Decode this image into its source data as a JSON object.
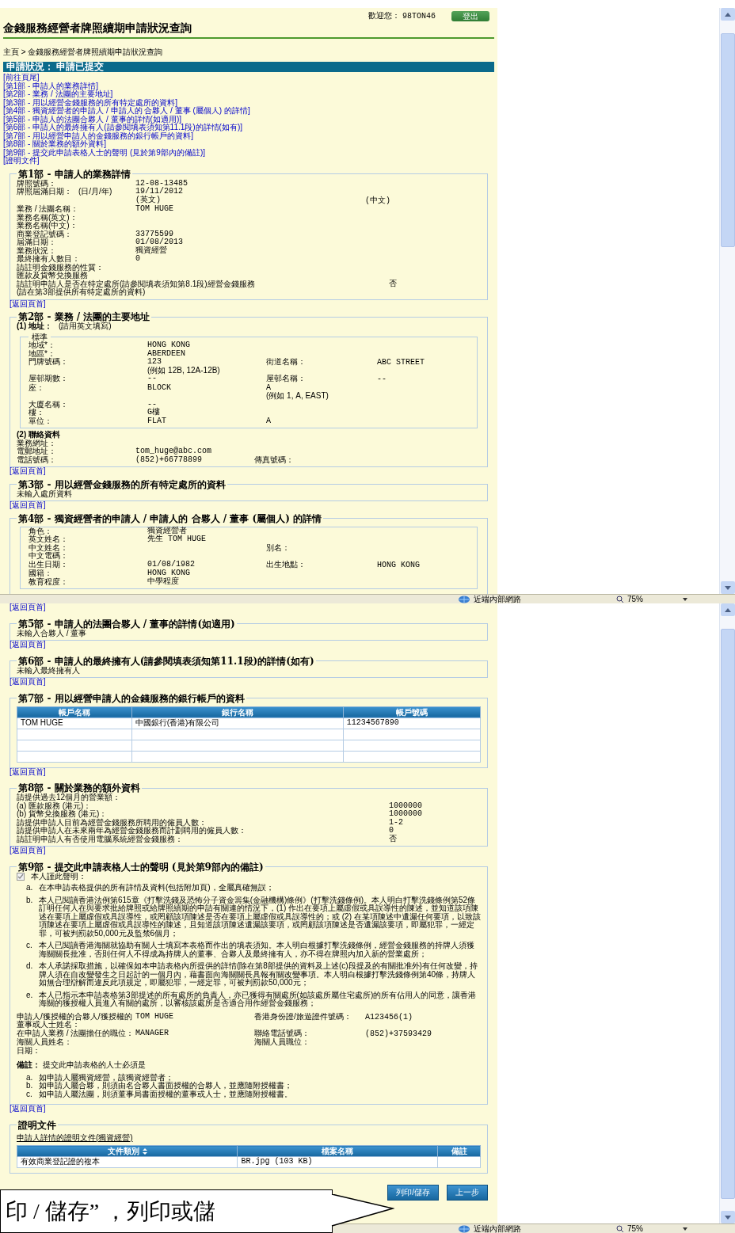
{
  "top_window": {
    "header": {
      "welcome": "歡迎您：",
      "user": "98TON46",
      "logout": "登出"
    },
    "title": "金錢服務經營者牌照續期申請狀況查詢",
    "breadcrumb": "主頁 > 金錢服務經營者牌照續期申請狀況查詢",
    "status_band": "申請狀況： 申請已提交",
    "nav_links": [
      "[前往頁尾]",
      "[第1部 - 申請人的業務詳情]",
      "[第2部 - 業務 / 法團的主要地址]",
      "[第3部 - 用以經營金錢服務的所有特定處所的資料]",
      "[第4部 - 獨資經營者的申請人 / 申請人的 合夥人 / 董事 (屬個人) 的詳情]",
      "[第5部 - 申請人的法團合夥人 / 董事的詳情(如適用)]",
      "[第6部 - 申請人的最終擁有人(請參閱填表須知第11.1段)的詳情(如有)]",
      "[第7部 - 用以經營申請人的金錢服務的銀行帳戶的資料]",
      "[第8部 - 關於業務的額外資料]",
      "[第9部 - 提交此申請表格人士的聲明 (見於第9部內的備註)]",
      "[證明文件]"
    ],
    "sections": [
      {
        "title": "第1部 - 申請人的業務詳情",
        "back_link": "[返回頁首]",
        "body": [
          {
            "kind": "row",
            "label": "牌照號碼：",
            "value": "12-08-13485"
          },
          {
            "kind": "row",
            "label": "牌照屆滿日期：",
            "label_note": "(日/月/年)",
            "value": "19/11/2012"
          },
          {
            "kind": "row",
            "value": "(英文)",
            "value2": "(中文)"
          },
          {
            "kind": "row",
            "label": "業務 / 法團名稱：",
            "value": "TOM HUGE"
          },
          {
            "kind": "row",
            "label": "業務名稱(英文)："
          },
          {
            "kind": "row",
            "label": "業務名稱(中文)："
          },
          {
            "kind": "row",
            "label": "商業登記號碼：",
            "value": "33775599"
          },
          {
            "kind": "row",
            "label": "屆滿日期：",
            "value": "01/08/2013"
          },
          {
            "kind": "row",
            "label": "業務狀況：",
            "value": "獨資經營"
          },
          {
            "kind": "row",
            "label": "最終擁有人數目：",
            "value": "0"
          },
          {
            "kind": "text",
            "text": "請註明金錢服務的性質："
          },
          {
            "kind": "text",
            "text": "匯款及貨幣兌換服務"
          },
          {
            "kind": "question",
            "text": "請註明申請人是否在特定處所(請參閱填表須知第8.1段)經營金錢服務",
            "answer": "否",
            "note": "(請在第3部提供所有特定處所的資料)"
          }
        ]
      },
      {
        "title": "第2部 - 業務 / 法團的主要地址",
        "back_link": "[返回頁首]",
        "body": [
          {
            "kind": "subhead",
            "text": "(1) 地址：",
            "note": "(請用英文填寫)"
          },
          {
            "kind": "group",
            "title": "標準",
            "items": [
              {
                "kind": "row",
                "label": "地域*：",
                "value": "HONG KONG"
              },
              {
                "kind": "row",
                "label": "地區*：",
                "value": "ABERDEEN"
              },
              {
                "kind": "row",
                "label": "門牌號碼：",
                "value": "123",
                "hint": "(例如 12B, 12A-12B)",
                "label2": "街道名稱：",
                "value2": "ABC STREET"
              },
              {
                "kind": "row",
                "label": "屋邨期數：",
                "value": "--",
                "label2": "屋邨名稱：",
                "value2": "--"
              },
              {
                "kind": "row",
                "label": "座：",
                "value": "BLOCK",
                "value_b": "A",
                "hint_b": "(例如 1, A, EAST)"
              },
              {
                "kind": "row",
                "label": "大廈名稱：",
                "value": "--"
              },
              {
                "kind": "row",
                "label": "樓：",
                "value": "G樓"
              },
              {
                "kind": "row",
                "label": "單位：",
                "value": "FLAT",
                "value_b": "A"
              }
            ]
          },
          {
            "kind": "subhead",
            "text": "(2) 聯絡資料"
          },
          {
            "kind": "row",
            "label": "業務網址："
          },
          {
            "kind": "row",
            "label": "電郵地址：",
            "value": "tom_huge@abc.com"
          },
          {
            "kind": "row",
            "label": "電話號碼：",
            "value": "(852)+66778899",
            "label2": "傳真號碼："
          }
        ]
      },
      {
        "title": "第3部 - 用以經營金錢服務的所有特定處所的資料",
        "back_link": "[返回頁首]",
        "body": [
          {
            "kind": "text",
            "text": "未輸入處所資料"
          }
        ]
      },
      {
        "title": "第4部 - 獨資經營者的申請人 / 申請人的 合夥人 / 董事 (屬個人) 的詳情",
        "body": [
          {
            "kind": "group",
            "items": [
              {
                "kind": "row",
                "label": "角色：",
                "value": "獨資經營者"
              },
              {
                "kind": "row",
                "label": "英文姓名：",
                "value": "先生 TOM HUGE"
              },
              {
                "kind": "row",
                "label": "中文姓名：",
                "label2": "別名："
              },
              {
                "kind": "row",
                "label": "中文電碼："
              },
              {
                "kind": "row",
                "label": "出生日期：",
                "value": "01/08/1982",
                "label2": "出生地點：",
                "value2": "HONG KONG"
              },
              {
                "kind": "row",
                "label": "國籍：",
                "value": "HONG KONG"
              },
              {
                "kind": "row",
                "label": "教育程度：",
                "value": "中學程度"
              }
            ]
          }
        ]
      }
    ],
    "status_bar": {
      "zone": "近端內部網路",
      "zoom": "75%"
    }
  },
  "bottom_window": {
    "top_link": "[返回頁首]",
    "sections": [
      {
        "title": "第5部 - 申請人的法團合夥人 / 董事的詳情(如適用)",
        "back_link": "[返回頁首]",
        "body": [
          {
            "kind": "text",
            "text": "未輸入合夥人 / 董事"
          }
        ]
      },
      {
        "title": "第6部 - 申請人的最終擁有人(請參閱填表須知第11.1段)的詳情(如有)",
        "back_link": "[返回頁首]",
        "body": [
          {
            "kind": "text",
            "text": "未輸入最終擁有人"
          }
        ]
      },
      {
        "title": "第7部 - 用以經營申請人的金錢服務的銀行帳戶的資料",
        "back_link": "[返回頁首]",
        "body": [
          {
            "kind": "table",
            "columns": [
              {
                "label": "帳戶名稱",
                "sortable": false
              },
              {
                "label": "銀行名稱",
                "sortable": false
              },
              {
                "label": "帳戶號碼",
                "sortable": false
              }
            ],
            "rows": [
              [
                "TOM HUGE",
                "中國銀行(香港)有限公司",
                "11234567890"
              ]
            ]
          }
        ]
      },
      {
        "title": "第8部 - 關於業務的額外資料",
        "back_link": "[返回頁首]",
        "body": [
          {
            "kind": "text",
            "text": "請提供過去12個月的營業額："
          },
          {
            "kind": "question",
            "text": "(a) 匯款服務 (港元)：",
            "answer": "1000000"
          },
          {
            "kind": "question",
            "text": "(b) 貨幣兌換服務 (港元)：",
            "answer": "1000000"
          },
          {
            "kind": "question",
            "text": "請提供申請人目前為經營金錢服務所聘用的僱員人數：",
            "answer": "1-2"
          },
          {
            "kind": "question",
            "text": "請提供申請人在未來兩年為經營金錢服務而計劃聘用的僱員人數：",
            "answer": "0"
          },
          {
            "kind": "question",
            "text": "請註明申請人有否使用電腦系統經營金錢服務：",
            "answer": "否"
          }
        ]
      },
      {
        "title": "第9部 - 提交此申請表格人士的聲明 (見於第9部內的備註)",
        "back_link": "[返回頁首]",
        "body": [
          {
            "kind": "declaration",
            "checkbox": {
              "label": "本人謹此聲明：",
              "checked": true
            },
            "clauses": [
              {
                "marker": "a.",
                "text": "在本申請表格提供的所有詳情及資料(包括附加頁)，全屬真確無誤；"
              },
              {
                "marker": "b.",
                "text": "本人已閱讀香港法例第615章《打擊洗錢及恐怖分子資金籌集(金融機構)條例》(打擊洗錢條例)。本人明白打擊洗錢條例第52條訂明任何人在與要求批給牌照或給牌照續期的申請有關連的情況下，(1) 作出在要項上屬虛假或具誤導性的陳述，並知道該項陳述在要項上屬虛假或具誤導性，或罔顧該項陳述是否在要項上屬虛假或具誤導性的；或 (2) 在某項陳述中遺漏任何要項，以致該項陳述在要項上屬虛假或具誤導性的陳述，且知道該項陳述遺漏該要項，或罔顧該項陳述是否遺漏該要項，即屬犯罪，一經定罪，可被判罰款50,000元及監禁6個月；"
              },
              {
                "marker": "c.",
                "text": "本人已閱讀香港海關就協助有關人士填寫本表格而作出的填表須知。本人明白根據打擊洗錢條例，經營金錢服務的持牌人須獲海關關長批准，否則任何人不得成為持牌人的董事、合夥人及最終擁有人，亦不得在牌照內加入新的營業處所；"
              },
              {
                "marker": "d.",
                "text": "本人承諾採取措施，以確保如本申請表格內所提供的詳情(除在第8部提供的資料及上述(c)段提及的有關批准外)有任何改變，持牌人須在自改變發生之日起計的一個月內，藉書面向海關關長具報有關改變事項。本人明白根據打擊洗錢條例第40條，持牌人如無合理辯解而違反此項規定，即屬犯罪，一經定罪，可被判罰款50,000元；"
              },
              {
                "marker": "e.",
                "text": "本人已指示本申請表格第3部提述的所有處所的負責人，亦已獲得有關處所(如該處所屬住宅處所)的所有佔用人的同意，讓香港海關的獲授權人員進入有關的處所，以審核該處所是否適合用作經營金錢服務；"
              }
            ]
          },
          {
            "kind": "row",
            "label": "申請人/獲授權的合夥人/獲授權的董事或人士姓名：",
            "value": "TOM HUGE",
            "label2": "香港身份證/旅遊證件號碼：",
            "value2": "A123456(1)"
          },
          {
            "kind": "row",
            "label": "在申請人業務 / 法團擔任的職位：",
            "value": "MANAGER",
            "label2": "聯絡電話號碼：",
            "value2": "(852)+37593429"
          },
          {
            "kind": "row",
            "label": "海關人員姓名：",
            "label2": "海關人員職位："
          },
          {
            "kind": "row",
            "label": "日期："
          },
          {
            "kind": "remark",
            "text": "**備註：** 提交此申請表格的人士必須是",
            "items": [
              {
                "marker": "a.",
                "text": "如申請人屬獨資經營，該獨資經營者；"
              },
              {
                "marker": "b.",
                "text": "如申請人屬合夥，則須由名合夥人書面授權的合夥人，並應隨附授權書；"
              },
              {
                "marker": "c.",
                "text": "如申請人屬法團，則須董事局書面授權的董事或人士，並應隨附授權書。"
              }
            ]
          }
        ]
      },
      {
        "title": "證明文件",
        "body": [
          {
            "kind": "link",
            "text": "申請人詳情的證明文件(獨資經營)"
          },
          {
            "kind": "table",
            "columns": [
              {
                "label": "文件類別",
                "sortable": true
              },
              {
                "label": "檔案名稱",
                "sortable": false
              },
              {
                "label": "備註",
                "sortable": false
              }
            ],
            "rows": [
              [
                "有效商業登記證的複本",
                "BR.jpg (103 KB)"
              ]
            ]
          }
        ]
      }
    ],
    "buttons": [
      "列印/儲存",
      "上一步"
    ],
    "status_bar": {
      "zone": "近端內部網路",
      "zoom": "75%"
    }
  },
  "callout": {
    "text": "印 / 儲存” ，列印或儲"
  }
}
